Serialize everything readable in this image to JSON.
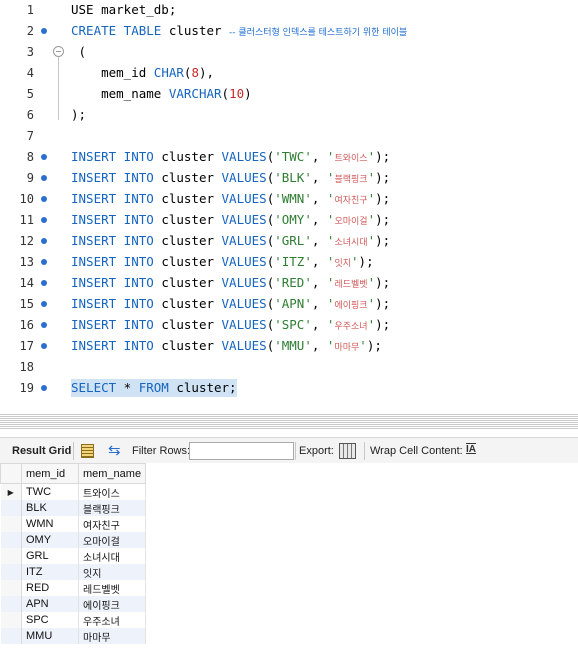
{
  "editor": {
    "lines": [
      {
        "num": "1",
        "bullet": false
      },
      {
        "num": "2",
        "bullet": true
      },
      {
        "num": "3",
        "bullet": false
      },
      {
        "num": "4",
        "bullet": false
      },
      {
        "num": "5",
        "bullet": false
      },
      {
        "num": "6",
        "bullet": false
      },
      {
        "num": "7",
        "bullet": false
      },
      {
        "num": "8",
        "bullet": true
      },
      {
        "num": "9",
        "bullet": true
      },
      {
        "num": "10",
        "bullet": true
      },
      {
        "num": "11",
        "bullet": true
      },
      {
        "num": "12",
        "bullet": true
      },
      {
        "num": "13",
        "bullet": true
      },
      {
        "num": "14",
        "bullet": true
      },
      {
        "num": "15",
        "bullet": true
      },
      {
        "num": "16",
        "bullet": true
      },
      {
        "num": "17",
        "bullet": true
      },
      {
        "num": "18",
        "bullet": false
      },
      {
        "num": "19",
        "bullet": true
      }
    ],
    "use_stmt": "USE market_db;",
    "create_kw": "CREATE TABLE",
    "table_name": " cluster ",
    "comment": "-- 클러스터형 인덱스를 테스트하기 위한 테이블",
    "open_paren": " (",
    "col1_name": "mem_id ",
    "col1_type": "CHAR",
    "col1_len": "8",
    "col2_name": "mem_name ",
    "col2_type": "VARCHAR",
    "col2_len": "10",
    "close_paren": ");",
    "insert_kw": "INSERT INTO",
    "values_kw": "VALUES",
    "insert_table": " cluster ",
    "select_kw1": "SELECT",
    "select_star": " * ",
    "select_kw2": "FROM",
    "select_rest": " cluster;"
  },
  "rows": [
    {
      "id": "TWC",
      "name": "트와이스"
    },
    {
      "id": "BLK",
      "name": "블랙핑크"
    },
    {
      "id": "WMN",
      "name": "여자친구"
    },
    {
      "id": "OMY",
      "name": "오마이걸"
    },
    {
      "id": "GRL",
      "name": "소녀시대"
    },
    {
      "id": "ITZ",
      "name": "잇지"
    },
    {
      "id": "RED",
      "name": "레드벨벳"
    },
    {
      "id": "APN",
      "name": "에이핑크"
    },
    {
      "id": "SPC",
      "name": "우주소녀"
    },
    {
      "id": "MMU",
      "name": "마마무"
    }
  ],
  "toolbar": {
    "result_grid": "Result Grid",
    "filter_rows": "Filter Rows:",
    "export": "Export:",
    "wrap": "Wrap Cell Content:",
    "wrap_icon": "IA"
  },
  "grid": {
    "col1": "mem_id",
    "col2": "mem_name",
    "row_marker": "▶"
  },
  "colors": {
    "keyword": "#1565c0",
    "string": "#2e7d32",
    "number": "#c62828",
    "selection": "#cfe3f5"
  }
}
